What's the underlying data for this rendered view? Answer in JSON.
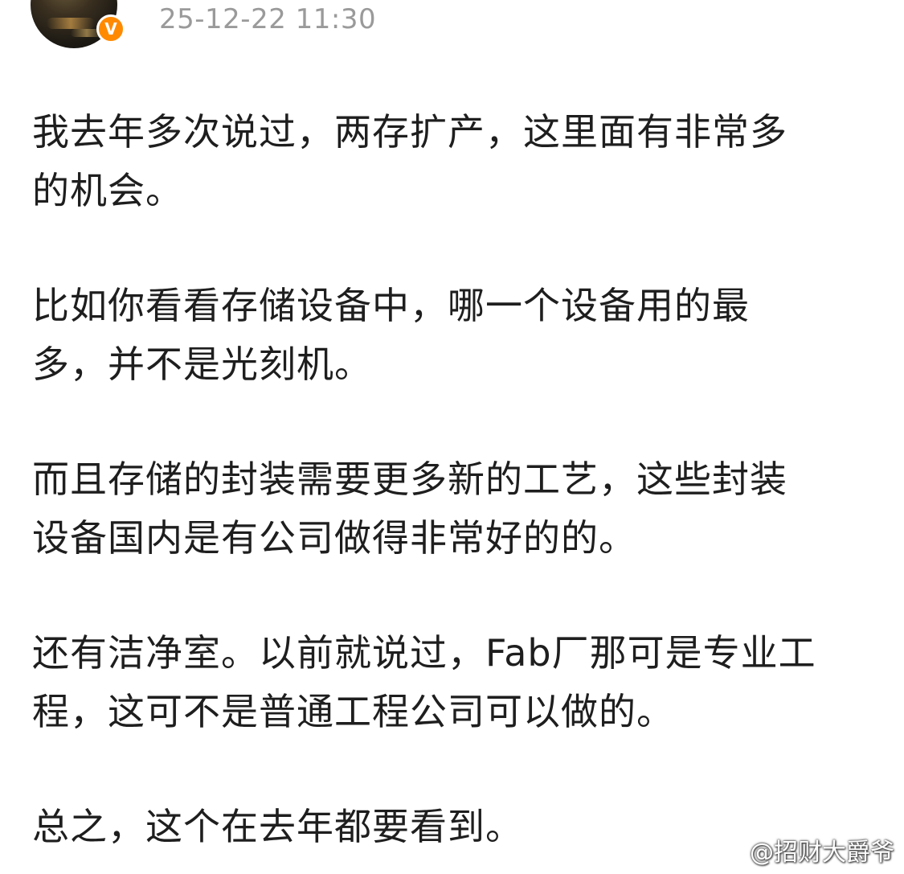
{
  "header": {
    "timestamp": "25-12-22 11:30",
    "verified_badge": "V"
  },
  "post": {
    "paragraphs": [
      "我去年多次说过，两存扩产，这里面有非常多\n的机会。",
      "比如你看看存储设备中，哪一个设备用的最\n多，并不是光刻机。",
      "而且存储的封装需要更多新的工艺，这些封装\n设备国内是有公司做得非常好的的。",
      "还有洁净室。以前就说过，Fab厂那可是专业工\n程，这可不是普通工程公司可以做的。",
      "总之，这个在去年都要看到。"
    ]
  },
  "watermark": {
    "text": "@招财大爵爷",
    "icon": "weibo-logo-icon"
  },
  "colors": {
    "badge": "#ff8a00",
    "timestamp": "#9a9a9a",
    "text": "#1e1e1e"
  }
}
